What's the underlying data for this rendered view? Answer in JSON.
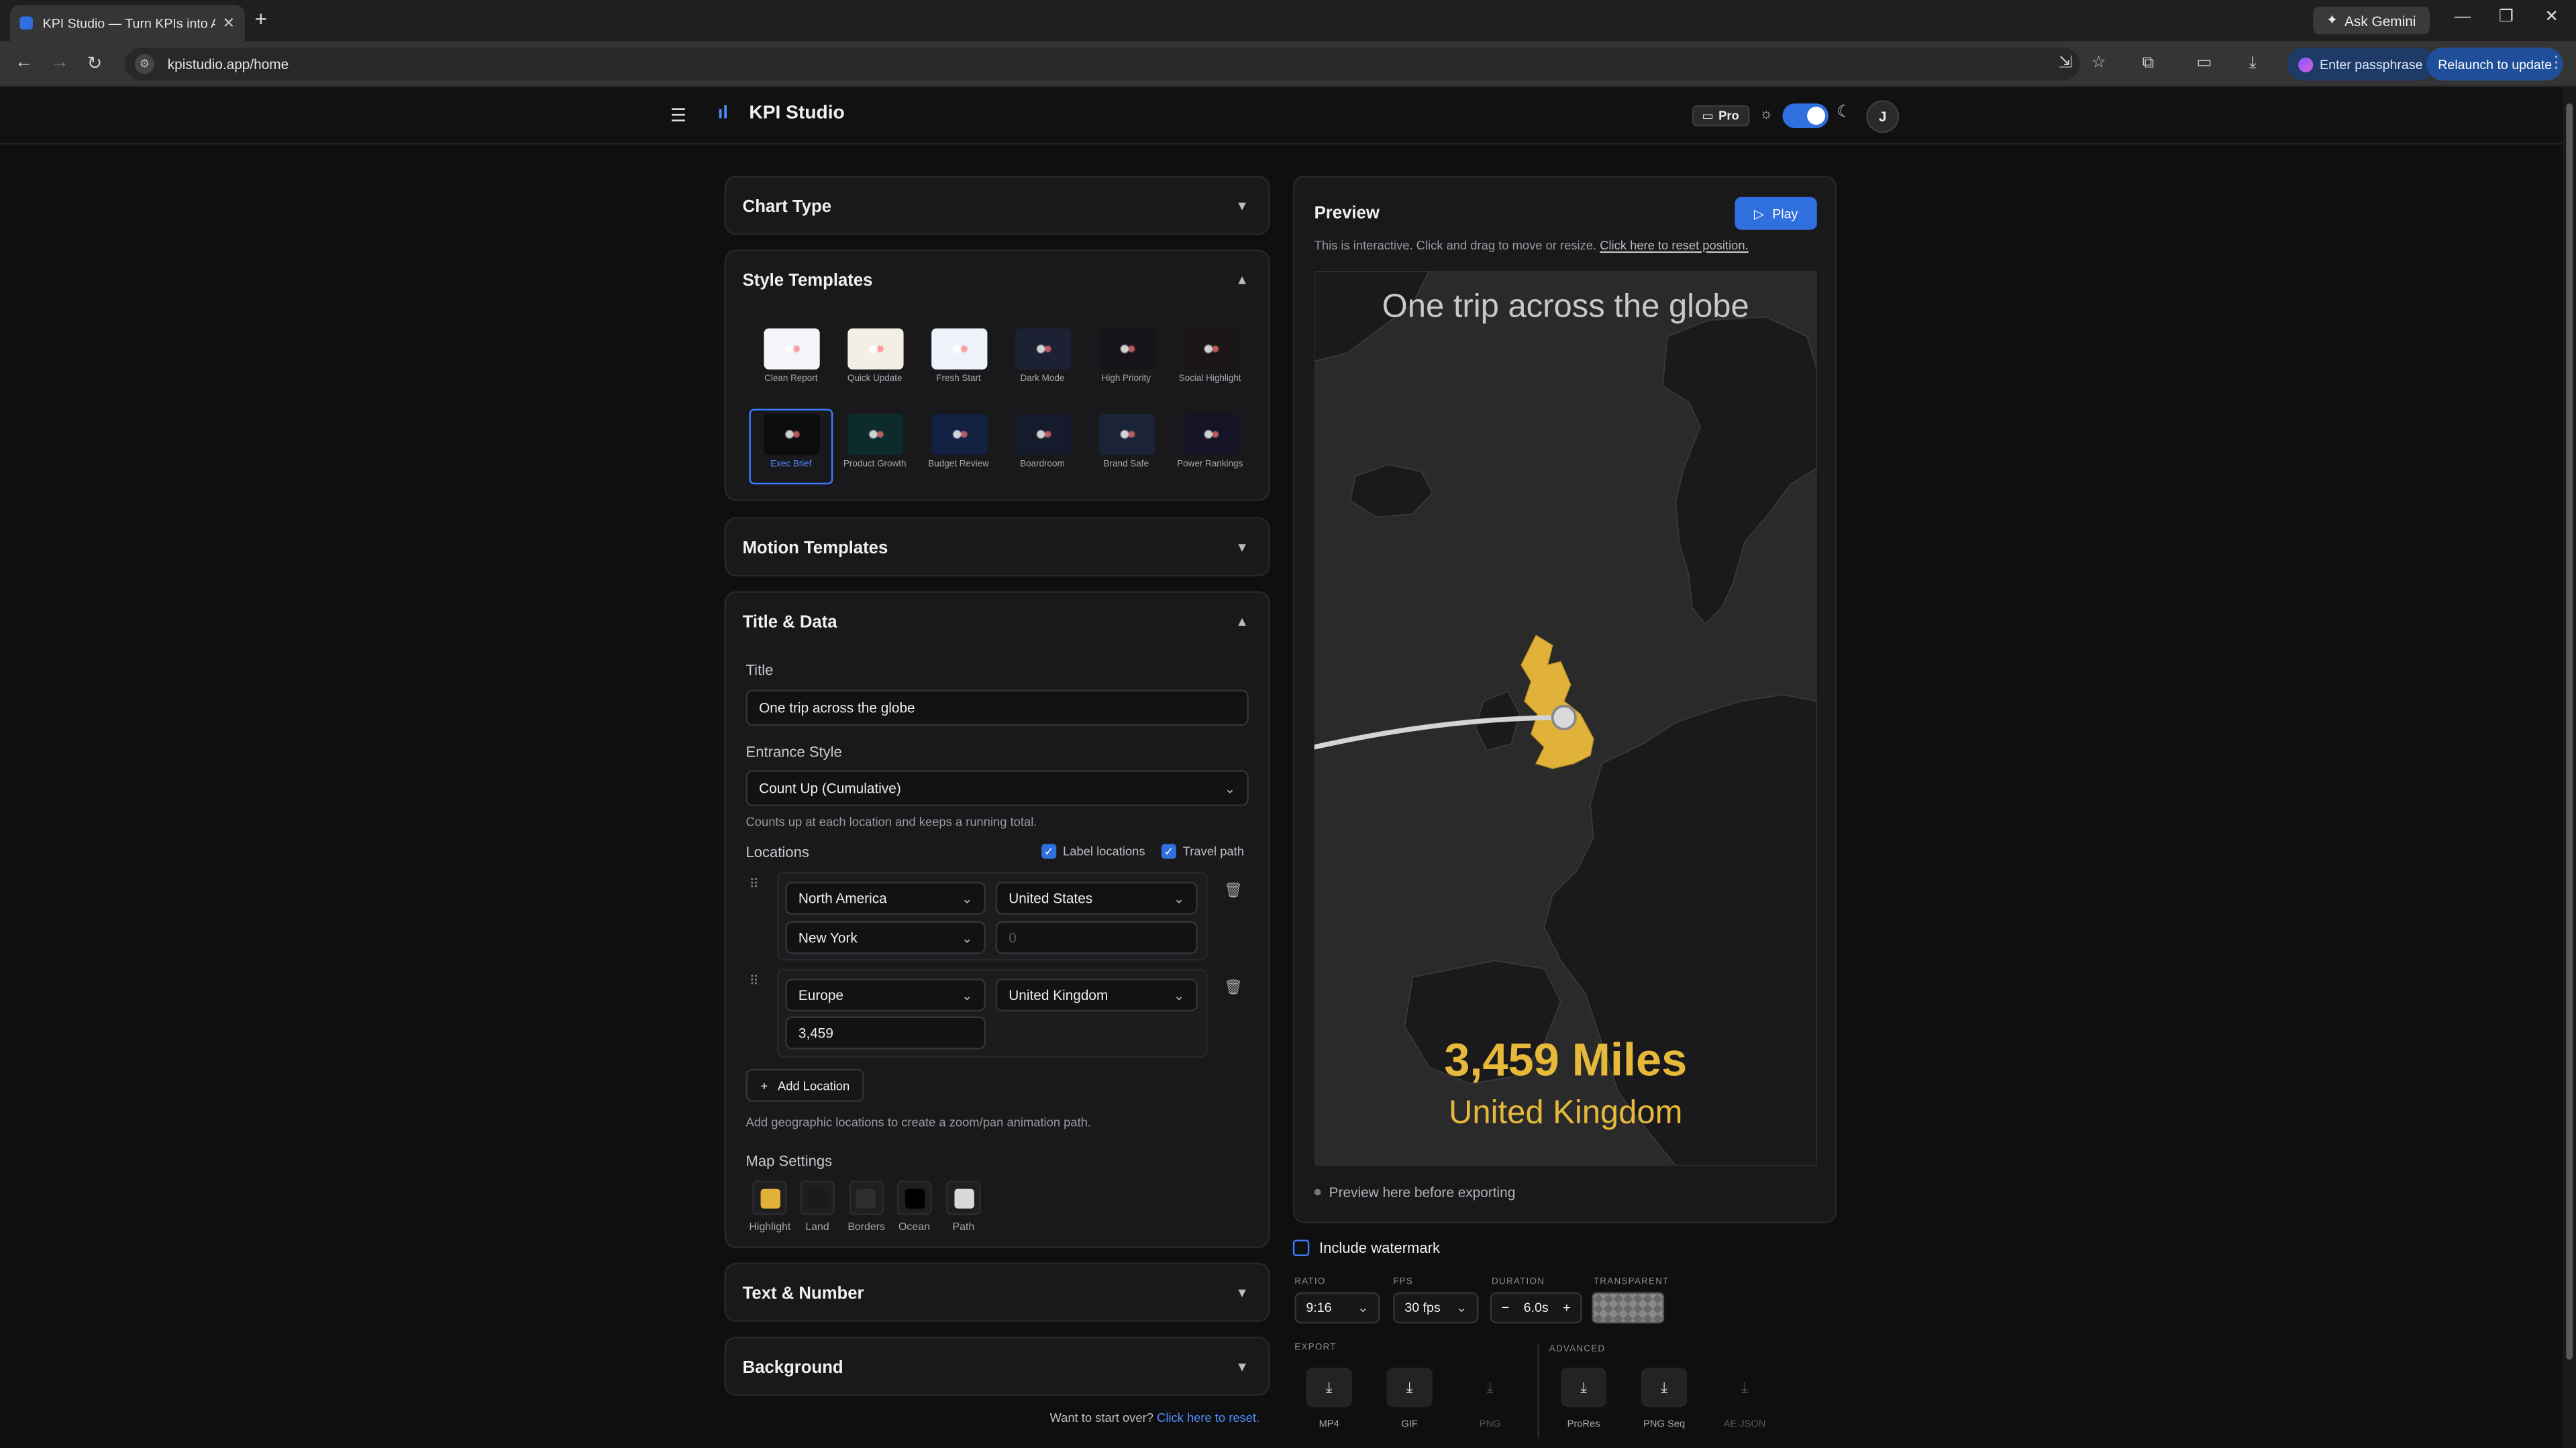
{
  "browser": {
    "tab_title": "KPI Studio — Turn KPIs into An",
    "url": "kpistudio.app/home",
    "ask_gemini": "Ask Gemini",
    "enter_passphrase": "Enter passphrase",
    "relaunch": "Relaunch to update"
  },
  "app": {
    "brand": "KPI Studio",
    "plan_badge": "Pro",
    "avatar_initial": "J"
  },
  "sections": {
    "chart_type": "Chart Type",
    "style_templates": "Style Templates",
    "motion_templates": "Motion Templates",
    "title_data": "Title & Data",
    "text_number": "Text & Number",
    "background": "Background"
  },
  "templates": [
    {
      "label": "Clean Report",
      "bg": "#f3f5f8"
    },
    {
      "label": "Quick Update",
      "bg": "#f4efe6"
    },
    {
      "label": "Fresh Start",
      "bg": "#eef3fb"
    },
    {
      "label": "Dark Mode",
      "bg": "#1c2233"
    },
    {
      "label": "High Priority",
      "bg": "#171419"
    },
    {
      "label": "Social Highlight",
      "bg": "#1b1518"
    },
    {
      "label": "Exec Brief",
      "bg": "#0c0c0e",
      "selected": true
    },
    {
      "label": "Product Growth",
      "bg": "#0d2b2b"
    },
    {
      "label": "Budget Review",
      "bg": "#122042"
    },
    {
      "label": "Boardroom",
      "bg": "#151b2c"
    },
    {
      "label": "Brand Safe",
      "bg": "#1b2436"
    },
    {
      "label": "Power Rankings",
      "bg": "#141426"
    }
  ],
  "title_data": {
    "title_label": "Title",
    "title_value": "One trip across the globe",
    "entrance_label": "Entrance Style",
    "entrance_value": "Count Up (Cumulative)",
    "entrance_hint": "Counts up at each location and keeps a running total.",
    "locations_label": "Locations",
    "label_locations": "Label locations",
    "travel_path": "Travel path",
    "loc1": {
      "region": "North America",
      "country": "United States",
      "city": "New York",
      "value_placeholder": "0"
    },
    "loc2": {
      "region": "Europe",
      "country": "United Kingdom",
      "value": "3,459"
    },
    "add_location": "Add Location",
    "add_hint": "Add geographic locations to create a zoom/pan animation path.",
    "map_settings": "Map Settings",
    "swatches": [
      {
        "label": "Highlight",
        "color": "#e0b23a"
      },
      {
        "label": "Land",
        "color": "#1a1a1c"
      },
      {
        "label": "Borders",
        "color": "#2e2e30"
      },
      {
        "label": "Ocean",
        "color": "#000000"
      },
      {
        "label": "Path",
        "color": "#d8d8d8"
      }
    ]
  },
  "restart": {
    "text": "Want to start over?",
    "link": "Click here to reset."
  },
  "preview": {
    "title": "Preview",
    "play": "Play",
    "hint": "This is interactive. Click and drag to move or resize.",
    "hint_link": "Click here to reset position.",
    "map_title": "One trip across the globe",
    "big_value": "3,459 Miles",
    "big_sub": "United Kingdom",
    "footer": "Preview here before exporting"
  },
  "export": {
    "watermark": "Include watermark",
    "ratio_label": "RATIO",
    "ratio": "9:16",
    "fps_label": "FPS",
    "fps": "30 fps",
    "duration_label": "DURATION",
    "duration": "6.0s",
    "transparent_label": "TRANSPARENT",
    "export_label": "EXPORT",
    "advanced_label": "ADVANCED",
    "buttons": [
      "MP4",
      "GIF",
      "PNG"
    ],
    "advanced_buttons": [
      "ProRes",
      "PNG Seq",
      "AE JSON"
    ]
  }
}
